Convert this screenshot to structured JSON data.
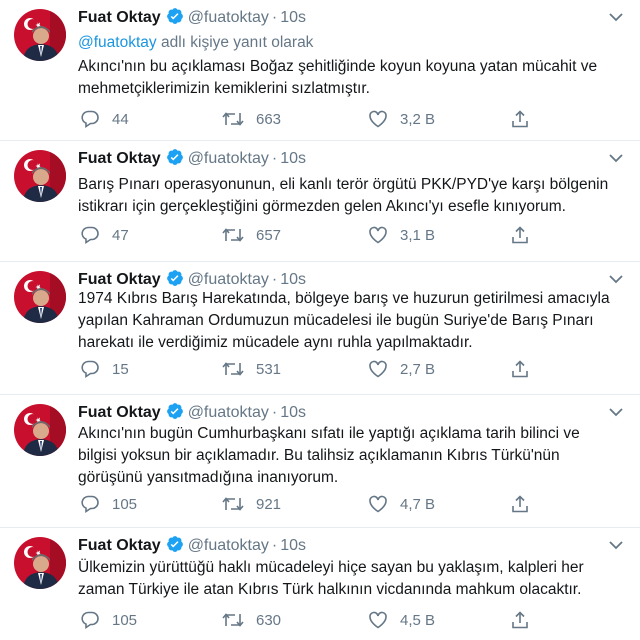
{
  "colors": {
    "accent": "#1da1f2",
    "muted": "#657786",
    "text": "#14171a"
  },
  "reply_to": {
    "mention": "@fuatoktay",
    "suffix": " adlı kişiye yanıt olarak"
  },
  "tweets": [
    {
      "name": "Fuat Oktay",
      "handle": "@fuatoktay",
      "separator": "·",
      "time": "10s",
      "text": "Akıncı'nın bu açıklaması Boğaz şehitliğinde koyun koyuna yatan mücahit ve mehmetçiklerimizin kemiklerini sızlatmıştır.",
      "replies": "44",
      "retweets": "663",
      "likes": "3,2 B"
    },
    {
      "name": "Fuat Oktay",
      "handle": "@fuatoktay",
      "separator": "·",
      "time": "10s",
      "text": "Barış Pınarı operasyonunun, eli kanlı terör örgütü PKK/PYD'ye karşı bölgenin istikrarı için gerçekleştiğini görmezden gelen Akıncı'yı esefle kınıyorum.",
      "replies": "47",
      "retweets": "657",
      "likes": "3,1 B"
    },
    {
      "name": "Fuat Oktay",
      "handle": "@fuatoktay",
      "separator": "·",
      "time": "10s",
      "text": "1974 Kıbrıs Barış Harekatında, bölgeye barış ve huzurun getirilmesi amacıyla yapılan Kahraman Ordumuzun mücadelesi ile bugün Suriye'de Barış Pınarı harekatı ile verdiğimiz mücadele aynı ruhla yapılmaktadır.",
      "replies": "15",
      "retweets": "531",
      "likes": "2,7 B"
    },
    {
      "name": "Fuat Oktay",
      "handle": "@fuatoktay",
      "separator": "·",
      "time": "10s",
      "text": "Akıncı'nın bugün Cumhurbaşkanı sıfatı ile yaptığı açıklama tarih bilinci ve bilgisi yoksun bir açıklamadır. Bu talihsiz açıklamanın Kıbrıs Türkü'nün görüşünü yansıtmadığına inanıyorum.",
      "replies": "105",
      "retweets": "921",
      "likes": "4,7 B"
    },
    {
      "name": "Fuat Oktay",
      "handle": "@fuatoktay",
      "separator": "·",
      "time": "10s",
      "text": "Ülkemizin yürüttüğü haklı mücadeleyi hiçe sayan bu yaklaşım, kalpleri her zaman Türkiye ile atan Kıbrıs Türk halkının vicdanında mahkum olacaktır.",
      "replies": "105",
      "retweets": "630",
      "likes": "4,5 B"
    }
  ]
}
